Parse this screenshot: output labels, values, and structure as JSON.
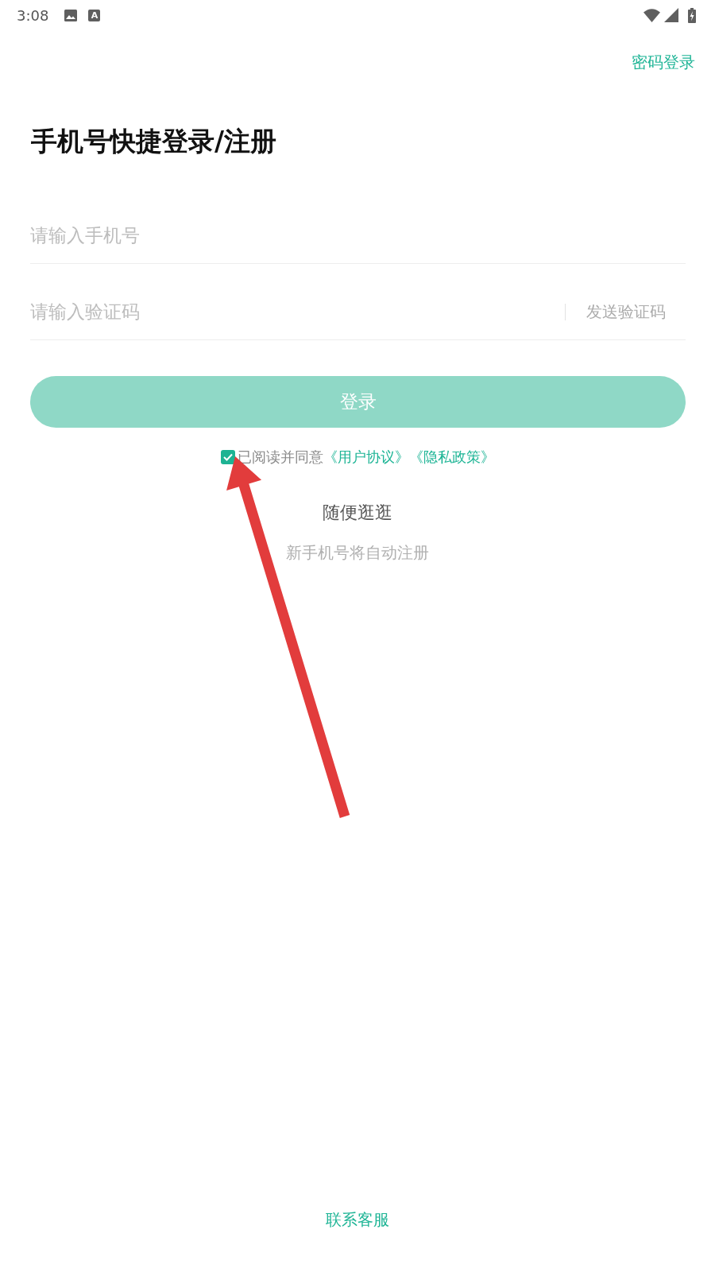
{
  "status_bar": {
    "time": "3:08",
    "badge": "A"
  },
  "header": {
    "link": "密码登录"
  },
  "title": "手机号快捷登录/注册",
  "form": {
    "phone_field": {
      "placeholder": "请输入手机号"
    },
    "code_field": {
      "placeholder": "请输入验证码",
      "action": "发送验证码"
    },
    "submit": {
      "label": "登录",
      "disabled": true
    }
  },
  "agreement": {
    "checked": true,
    "text": "已阅读并同意",
    "links": [
      "《用户协议》",
      "《隐私政策》"
    ]
  },
  "browse_link": "随便逛逛",
  "hint": "新手机号将自动注册",
  "footer_link": "联系客服"
}
